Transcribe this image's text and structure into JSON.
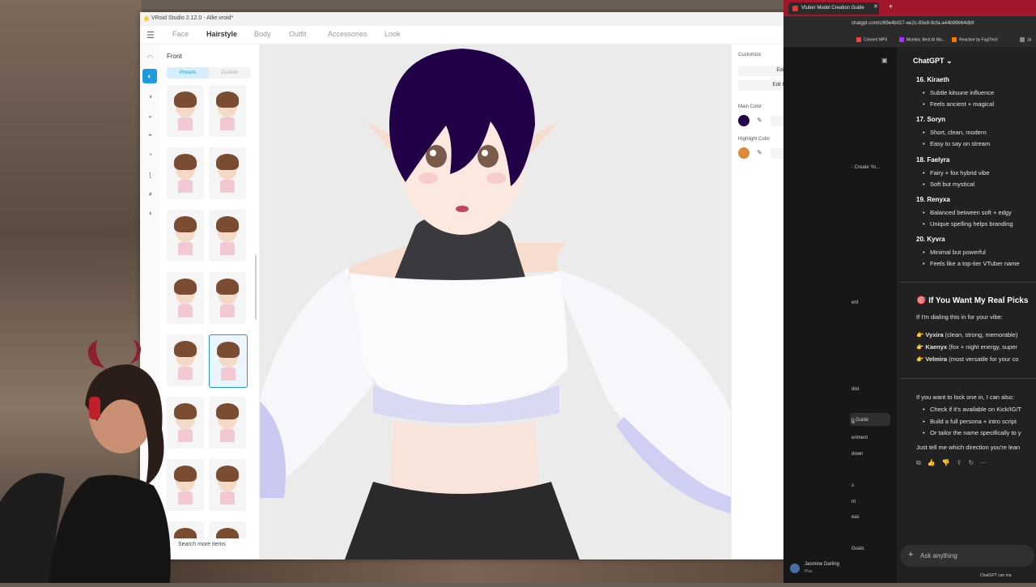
{
  "vroid": {
    "window_title": "VRoid Studio 2.12.0 - Allie.vroid*",
    "nav_tabs": [
      "Face",
      "Hairstyle",
      "Body",
      "Outfit",
      "Accessories",
      "Look"
    ],
    "panel_title": "Front",
    "segments": {
      "presets": "Presets",
      "custom": "Custom"
    },
    "search_more": "Search more items",
    "customize": {
      "title": "Customize",
      "edit_hairstyle": "Edit Hairstyle",
      "edit_hair_bounce": "Edit Hair Bounce",
      "main_color_label": "Main Color",
      "main_color_hex": "#210047",
      "main_color": "#210047",
      "highlight_color_label": "Highlight Color",
      "highlight_color_hex": "#DB8A3B",
      "highlight_color": "#DB8A3B"
    },
    "accent": "#1e9be0"
  },
  "browser": {
    "tab_title": "Vtuber Model Creation Guide",
    "url": "chatgpt.com/c/69e4b027-ee2c-83e8-8cfa-a44b99b64db9",
    "bookmarks": [
      "Convert MP3",
      "Mureka: Best AI Mu...",
      "Reactive by FugiTech",
      "Ja"
    ],
    "app_title": "ChatGPT",
    "sidebar_items": [
      "- Create Yo...",
      "ent",
      "n Guide",
      "dist",
      "w",
      "eriment",
      "down",
      "s",
      "nt",
      "eas",
      "Goals"
    ],
    "user_name": "Jasmine Darling",
    "user_plan": "Plus"
  },
  "chat": {
    "items": [
      {
        "title": "16. Kiraeth",
        "bullets": [
          "Subtle kitsune influence",
          "Feels ancient + magical"
        ]
      },
      {
        "title": "17. Soryn",
        "bullets": [
          "Short, clean, modern",
          "Easy to say on stream"
        ]
      },
      {
        "title": "18. Faelyra",
        "bullets": [
          "Fairy + fox hybrid vibe",
          "Soft but mystical"
        ]
      },
      {
        "title": "19. Renyxa",
        "bullets": [
          "Balanced between soft + edgy",
          "Unique spelling helps branding"
        ]
      },
      {
        "title": "20. Kyvra",
        "bullets": [
          "Minimal but powerful",
          "Feels like a top-tier VTuber name"
        ]
      }
    ],
    "picks_heading": "🎯 If You Want My Real Picks",
    "picks_intro": "If I'm dialing this in for your vibe:",
    "picks": [
      {
        "name": "👉 Vyxira",
        "desc": " (clean, strong, memorable)"
      },
      {
        "name": "👉 Kaenyx",
        "desc": " (fox + night energy, super"
      },
      {
        "name": "👉 Velmira",
        "desc": " (most versatile for your co"
      }
    ],
    "lock_intro": "If you want to lock one in, I can also:",
    "lock_options": [
      "Check if it's available on Kick/IG/T",
      "Build a full persona + intro script",
      "Or tailor the name specifically to y"
    ],
    "closing": "Just tell me which direction you're lean",
    "ask_placeholder": "Ask anything",
    "footnote": "ChatGPT can ma"
  }
}
